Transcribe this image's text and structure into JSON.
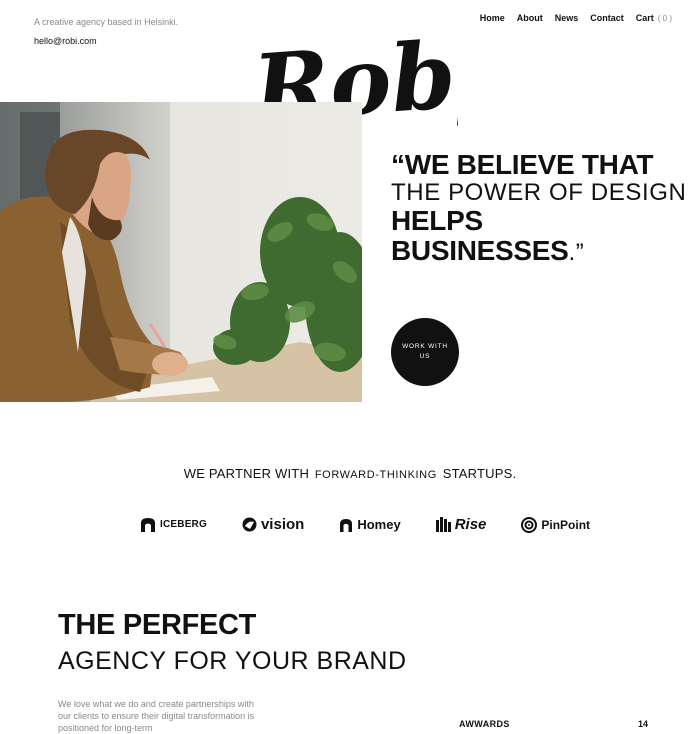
{
  "header": {
    "tagline": "A creative agency based in Helsinki.",
    "email": "hello@robi.com",
    "logo_text": "Roby",
    "nav": {
      "home": "Home",
      "about": "About",
      "news": "News",
      "contact": "Contact",
      "cart": "Cart",
      "cart_count": "( 0 )"
    }
  },
  "hero": {
    "image": "man-writing-at-desk-with-plants",
    "quote": {
      "line1": "“WE BELIEVE THAT",
      "line2": "THE POWER OF DESIGN",
      "line3": "HELPS",
      "line4": "BUSINESSES",
      "line4_end": ".”"
    },
    "cta_label": "WORK WITH US"
  },
  "partners": {
    "heading_start": "WE PARTNER WITH",
    "heading_mid": "FORWARD-THINKING",
    "heading_end": "STARTUPS.",
    "logos": [
      "ICEBERG",
      "vision",
      "Homey",
      "Rise",
      "PinPoint"
    ]
  },
  "about": {
    "title_line1": "THE PERFECT",
    "title_line2": "AGENCY FOR YOUR BRAND",
    "paragraph": "We love what we do and create partnerships with our clients to ensure their digital transformation is positioned for long-term",
    "awards_label": "AWWARDS",
    "awards_count": "14"
  },
  "colors": {
    "text": "#111111",
    "muted": "#8a8a8a",
    "button": "#111111"
  }
}
